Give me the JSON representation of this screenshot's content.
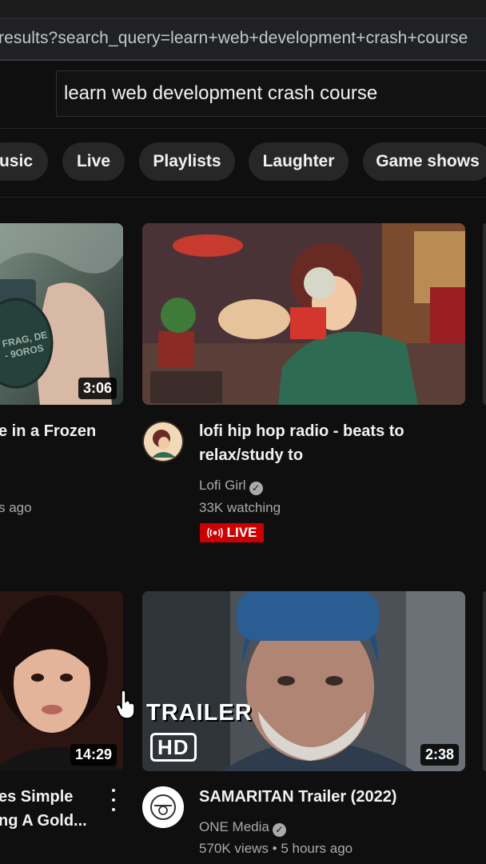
{
  "browser": {
    "url": "results?search_query=learn+web+development+crash+course"
  },
  "search": {
    "query": "learn web development crash course"
  },
  "chips": [
    "usic",
    "Live",
    "Playlists",
    "Laughter",
    "Game shows"
  ],
  "videos": [
    {
      "title_lines": [
        "e in a Frozen"
      ],
      "meta_line": "s ago",
      "duration": "3:06",
      "thumb_text": [
        "FRAG, DE",
        "- 9OROS"
      ]
    },
    {
      "title_lines": [
        "lofi hip hop radio - beats to",
        "relax/study to"
      ],
      "channel": "Lofi Girl",
      "verified": true,
      "stats": "33K watching",
      "badge": "LIVE"
    },
    {
      "title_lines": [
        "es Simple",
        "ng A Gold..."
      ],
      "duration": "14:29"
    },
    {
      "title_lines": [
        "SAMARITAN Trailer (2022)"
      ],
      "channel": "ONE Media",
      "verified": true,
      "stats": "570K views • 5 hours ago",
      "duration": "2:38",
      "thumb_text": [
        "TRAILER",
        "HD"
      ]
    }
  ],
  "colors": {
    "background": "#0f0f0f",
    "chip": "#272727",
    "live_red": "#cc0000",
    "secondary_text": "#aaaaaa"
  }
}
